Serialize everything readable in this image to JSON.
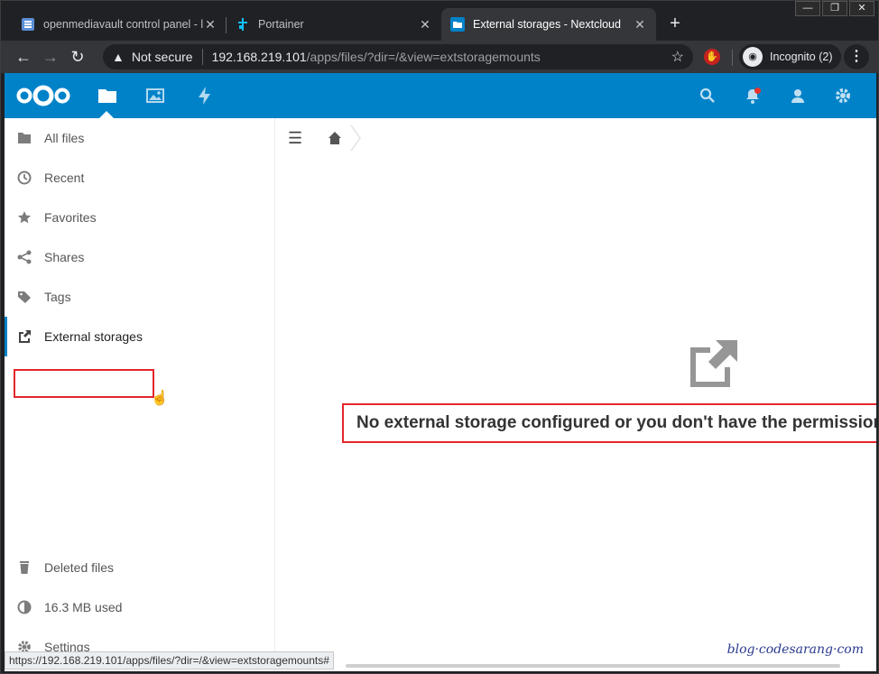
{
  "browser": {
    "window_controls": [
      "—",
      "❐",
      "✕"
    ],
    "tabs": [
      {
        "title": "openmediavault control panel - l",
        "active": false
      },
      {
        "title": "Portainer",
        "active": false
      },
      {
        "title": "External storages - Nextcloud",
        "active": true
      }
    ],
    "newtab_label": "+",
    "address": {
      "security_label": "Not secure",
      "host": "192.168.219.101",
      "path": "/apps/files/?dir=/&view=extstoragemounts"
    },
    "incognito_label": "Incognito (2)",
    "status_url": "https://192.168.219.101/apps/files/?dir=/&view=extstoragemounts#"
  },
  "header": {
    "brand_color": "#0082c9",
    "apps": [
      "files-icon",
      "photos-icon",
      "activity-icon"
    ],
    "right_icons": [
      "search-icon",
      "notifications-icon",
      "contacts-icon",
      "settings-icon"
    ]
  },
  "sidebar": {
    "items": [
      {
        "label": "All files",
        "icon": "folder-icon"
      },
      {
        "label": "Recent",
        "icon": "clock-icon"
      },
      {
        "label": "Favorites",
        "icon": "star-icon"
      },
      {
        "label": "Shares",
        "icon": "share-icon"
      },
      {
        "label": "Tags",
        "icon": "tag-icon"
      },
      {
        "label": "External storages",
        "icon": "external-link-icon",
        "selected": true
      }
    ],
    "bottom": [
      {
        "label": "Deleted files",
        "icon": "trash-icon"
      },
      {
        "label": "16.3 MB used",
        "icon": "quota-icon"
      },
      {
        "label": "Settings",
        "icon": "gear-icon"
      }
    ]
  },
  "main": {
    "empty_message": "No external storage configured or you don't have the permission to configure them"
  },
  "watermark": "blog·codesarang·com"
}
